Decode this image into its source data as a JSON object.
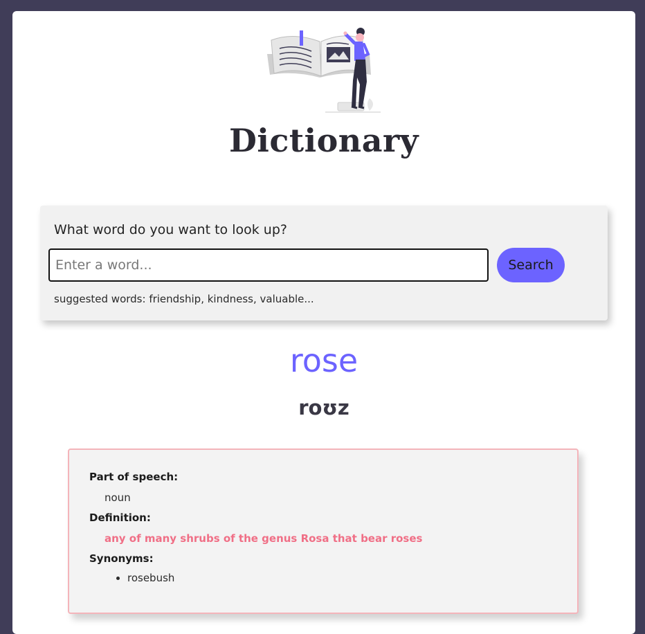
{
  "app": {
    "title": "Dictionary"
  },
  "search": {
    "prompt": "What word do you want to look up?",
    "placeholder": "Enter a word...",
    "value": "",
    "button_label": "Search",
    "suggested": "suggested words: friendship, kindness, valuable..."
  },
  "result": {
    "word": "rose",
    "phonetic": "roʊz",
    "meaning": {
      "part_of_speech_label": "Part of speech:",
      "part_of_speech": "noun",
      "definition_label": "Definition:",
      "definition": "any of many shrubs of the genus Rosa that bear roses",
      "synonyms_label": "Synonyms:",
      "synonyms": [
        "rosebush"
      ]
    }
  },
  "colors": {
    "background": "#403d58",
    "accent": "#6c63ff",
    "definition": "#f06f86",
    "meaning_border": "#f4b4ba"
  },
  "hero": {
    "icon": "reading-book-illustration"
  }
}
